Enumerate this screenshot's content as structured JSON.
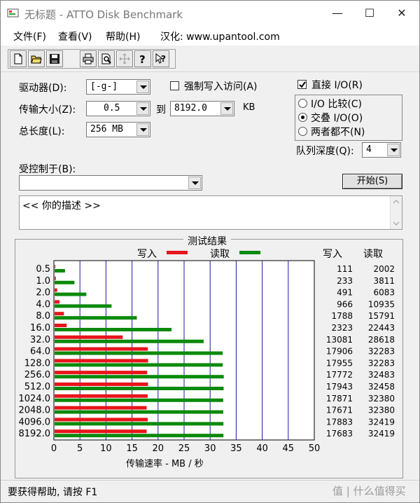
{
  "window": {
    "title": "无标题 - ATTO Disk Benchmark"
  },
  "menu": {
    "file": "文件(F)",
    "view": "查看(V)",
    "help": "帮助(H)",
    "localized": "汉化: www.upantool.com"
  },
  "toolbar": {
    "icons": [
      "new-file-icon",
      "open-folder-icon",
      "save-icon",
      "print-icon",
      "print-preview-icon",
      "move-icon",
      "help-icon",
      "context-help-icon"
    ]
  },
  "form": {
    "drive_label": "驱动器(D):",
    "drive_value": "[-g-]",
    "force_write_label": "强制写入访问(A)",
    "force_write_checked": false,
    "transfer_label": "传输大小(Z):",
    "transfer_from": "0.5",
    "to_label": "到",
    "transfer_to": "8192.0",
    "kb_label": "KB",
    "total_label": "总长度(L):",
    "total_value": "256 MB",
    "direct_io_label": "直接 I/O(R)",
    "direct_io_checked": true,
    "io_compare_label": "I/O 比较(C)",
    "overlap_io_label": "交叠 I/O(O)",
    "neither_label": "两者都不(N)",
    "io_selected": "overlap",
    "queue_label": "队列深度(Q):",
    "queue_value": "4",
    "controlled_label": "受控制于(B):",
    "controlled_value": "",
    "start_button": "开始(S)",
    "description": "<<  你的描述   >>"
  },
  "results": {
    "title": "测试结果",
    "legend_write": "写入",
    "legend_read": "读取",
    "col_write": "写入",
    "col_read": "读取",
    "x_axis_label": "传输速率 - MB / 秒",
    "write_color": "#e8141b",
    "read_color": "#0b8a0b",
    "grid_color": "#1a1aa0"
  },
  "chart_data": {
    "type": "bar",
    "orientation": "horizontal",
    "categories": [
      "0.5",
      "1.0",
      "2.0",
      "4.0",
      "8.0",
      "16.0",
      "32.0",
      "64.0",
      "128.0",
      "256.0",
      "512.0",
      "1024.0",
      "2048.0",
      "4096.0",
      "8192.0"
    ],
    "series": [
      {
        "name": "写入",
        "values": [
          111,
          233,
          491,
          966,
          1788,
          2323,
          13081,
          17906,
          17955,
          17772,
          17943,
          17871,
          17671,
          17883,
          17683
        ],
        "color": "#e8141b"
      },
      {
        "name": "读取",
        "values": [
          2002,
          3811,
          6083,
          10935,
          15791,
          22443,
          28618,
          32283,
          32283,
          32483,
          32458,
          32380,
          32380,
          32419,
          32419
        ],
        "color": "#0b8a0b"
      }
    ],
    "xlabel": "传输速率 - MB / 秒",
    "xticks": [
      "0",
      "5",
      "10",
      "15",
      "20",
      "25",
      "30",
      "35",
      "40",
      "45",
      "50"
    ],
    "xlim": [
      0,
      50
    ],
    "scale_note": "bars in MB/s (values shown are KB/s)"
  },
  "status": {
    "text": "要获得帮助, 请按 F1",
    "watermark": "值 | 什么值得买"
  }
}
